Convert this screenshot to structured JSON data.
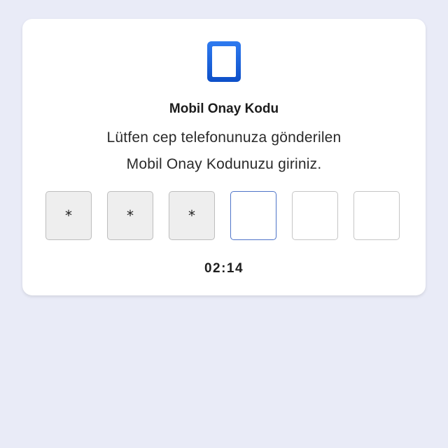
{
  "card": {
    "icon": "mobile-phone-icon",
    "title": "Mobil Onay Kodu",
    "description_line1": "Lütfen cep telefonunuza gönderilen",
    "description_line2": "Mobil Onay Kodunuzu giriniz.",
    "otp_digits": [
      "*",
      "*",
      "*",
      "",
      "",
      ""
    ],
    "timer": "02:14"
  },
  "colors": {
    "background": "#e9ebf7",
    "icon_blue": "#1565e0",
    "active_border": "#4f74c8"
  }
}
